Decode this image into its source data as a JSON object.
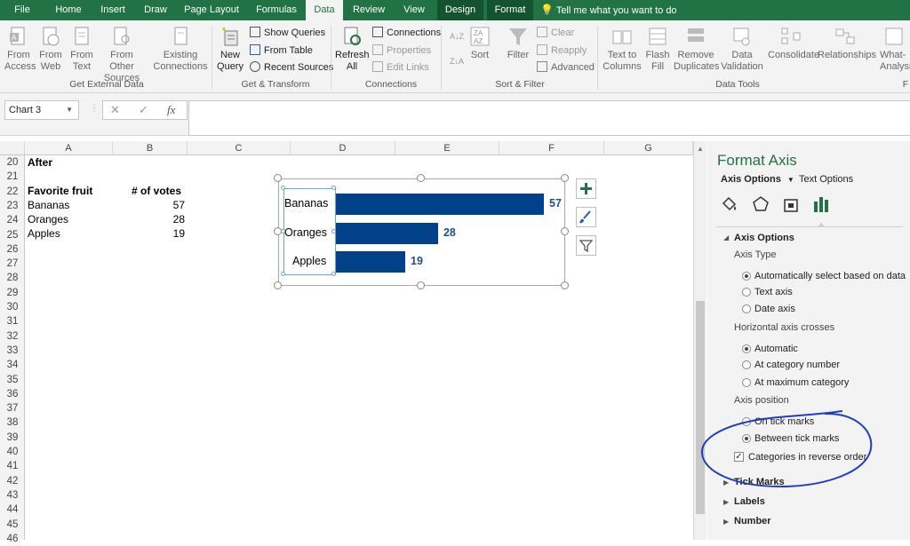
{
  "tabs": [
    "File",
    "Home",
    "Insert",
    "Draw",
    "Page Layout",
    "Formulas",
    "Data",
    "Review",
    "View",
    "Design",
    "Format"
  ],
  "tell_me": "Tell me what you want to do",
  "ribbon": {
    "get_external": {
      "from_access": "From\nAccess",
      "from_web": "From\nWeb",
      "from_text": "From\nText",
      "from_other": "From Other\nSources",
      "existing": "Existing\nConnections",
      "group": "Get External Data"
    },
    "get_transform": {
      "new_query": "New\nQuery",
      "show_queries": "Show Queries",
      "from_table": "From Table",
      "recent_sources": "Recent Sources",
      "group": "Get & Transform"
    },
    "connections": {
      "refresh_all": "Refresh\nAll",
      "connections": "Connections",
      "properties": "Properties",
      "edit_links": "Edit Links",
      "group": "Connections"
    },
    "sort_filter": {
      "sort": "Sort",
      "filter": "Filter",
      "clear": "Clear",
      "reapply": "Reapply",
      "advanced": "Advanced",
      "group": "Sort & Filter"
    },
    "data_tools": {
      "text_to_columns": "Text to\nColumns",
      "flash_fill": "Flash\nFill",
      "remove_duplicates": "Remove\nDuplicates",
      "data_validation": "Data\nValidation",
      "consolidate": "Consolidate",
      "relationships": "Relationships",
      "whatif": "What-\nAnalysi",
      "group": "Data Tools",
      "next_group": "F"
    }
  },
  "formula_bar": {
    "name_box": "Chart 3",
    "cancel": "✕",
    "enter": "✓",
    "fx": "fx",
    "content": ""
  },
  "columns": [
    "A",
    "B",
    "C",
    "D",
    "E",
    "F",
    "G"
  ],
  "rows": [
    "20",
    "21",
    "22",
    "23",
    "24",
    "25",
    "26",
    "27",
    "28",
    "29",
    "30",
    "31",
    "32",
    "33",
    "34",
    "35",
    "36",
    "37",
    "38",
    "39",
    "40",
    "41",
    "42",
    "43",
    "44",
    "45",
    "46"
  ],
  "sheet": {
    "after_label": "After",
    "header_fruit": "Favorite fruit",
    "header_votes": "# of votes",
    "data": [
      {
        "fruit": "Bananas",
        "votes": "57"
      },
      {
        "fruit": "Oranges",
        "votes": "28"
      },
      {
        "fruit": "Apples",
        "votes": "19"
      }
    ]
  },
  "chart_data": {
    "type": "bar",
    "orientation": "horizontal",
    "categories": [
      "Bananas",
      "Oranges",
      "Apples"
    ],
    "values": [
      57,
      28,
      19
    ],
    "title": "",
    "xlabel": "",
    "ylabel": "",
    "xlim": [
      0,
      60
    ],
    "grid": false,
    "legend": "none",
    "bar_color": "#00418a",
    "label_color": "#1f4e8c"
  },
  "chart_tools": [
    "plus-icon",
    "brush-icon",
    "filter-icon"
  ],
  "panel": {
    "title": "Format Axis",
    "tab_axis_options": "Axis Options",
    "tab_text_options": "Text Options",
    "section_axis_options": "Axis Options",
    "axis_type_label": "Axis Type",
    "axis_type_options": [
      {
        "label": "Automatically select based on data",
        "selected": true
      },
      {
        "label": "Text axis",
        "selected": false
      },
      {
        "label": "Date axis",
        "selected": false
      }
    ],
    "h_axis_crosses_label": "Horizontal axis crosses",
    "h_axis_options": [
      {
        "label": "Automatic",
        "selected": true
      },
      {
        "label": "At category number",
        "selected": false
      },
      {
        "label": "At maximum category",
        "selected": false
      }
    ],
    "axis_position_label": "Axis position",
    "axis_position_options": [
      {
        "label": "On tick marks",
        "selected": false
      },
      {
        "label": "Between tick marks",
        "selected": true
      }
    ],
    "reverse_order_label": "Categories in reverse order",
    "reverse_order_checked": true,
    "sections_collapsed": [
      "Tick Marks",
      "Labels",
      "Number"
    ],
    "accent_color": "#217346",
    "annotation_color": "#1f3fbf"
  }
}
